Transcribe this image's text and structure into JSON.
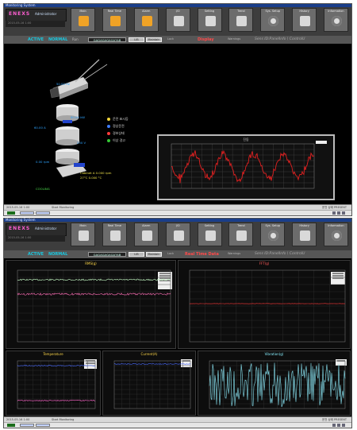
{
  "screen1": {
    "title_bar": "Monitoring System",
    "brand": "ENEXS",
    "user": "Administrator",
    "nav": [
      {
        "label": "Main",
        "icon": "home-icon"
      },
      {
        "label": "Real Time",
        "icon": "flow-icon"
      },
      {
        "label": "Alarm",
        "icon": "alarm-icon"
      },
      {
        "label": "I/O",
        "icon": "io-icon"
      },
      {
        "label": "Setting",
        "icon": "setting-icon"
      },
      {
        "label": "Trend",
        "icon": "trend-icon"
      },
      {
        "label": "Sys. Setup",
        "icon": "gear-icon"
      },
      {
        "label": "History",
        "icon": "history-icon"
      },
      {
        "label": "Information",
        "icon": "info-icon"
      }
    ],
    "status": {
      "active": "ACTIVE",
      "mode_state": "NORMAL",
      "run_label": "Run",
      "code": "GAGAGAGAGA?AB",
      "btn1": "LIB",
      "btn2": "Maintain",
      "lock": "Lock",
      "mode": "Display",
      "right_label": "Warnings",
      "path": "Sens ID:PanelInfo \\ ControlU"
    },
    "legend": [
      {
        "label": "운전 표시등",
        "color": "#f2d63b"
      },
      {
        "label": "정상운전",
        "color": "#3f7dff"
      },
      {
        "label": "경보상태",
        "color": "#ff3b3b"
      },
      {
        "label": "이상 경고",
        "color": "#34c934"
      }
    ],
    "callouts": [
      {
        "text": "50.00 Hz",
        "cls": ""
      },
      {
        "text": "80.00 kW",
        "cls": ""
      },
      {
        "text": "60.00 A",
        "cls": ""
      },
      {
        "text": "230 V",
        "cls": ""
      },
      {
        "text": "0.00 rpm",
        "cls": ""
      },
      {
        "text": "Cabinet A 0.000 rpm",
        "cls": "y"
      },
      {
        "text": "27°C 0.000 °C",
        "cls": "y"
      },
      {
        "text": "COOLING",
        "cls": "g"
      }
    ],
    "monitor_title": "진동",
    "bottom": {
      "left": "2015-05-16 1:00",
      "mid": "Start Monitoring",
      "right": "운전 상태 PRESENT"
    }
  },
  "screen2": {
    "title_bar": "Monitoring System",
    "brand": "ENEXS",
    "user": "Administrator",
    "status": {
      "active": "ACTIVE",
      "mode_state": "NORMAL",
      "code": "GAGAGAGAGA?AB",
      "btn1": "LIB",
      "btn2": "Maintain",
      "lock": "Lock",
      "mode": "Real Time Data",
      "right_label": "Warnings",
      "path": "Sens ID:PanelInfo \\ ControlU"
    },
    "panel_titles": {
      "top_left": "RMS(g)",
      "top_right": "FFT(g)",
      "bottom_left": "Temperature",
      "bottom_mid": "Current(A)",
      "bottom_right": "Vibration(g)"
    },
    "bottom": {
      "left": "2015-05-16 1:00",
      "mid": "Start Monitoring",
      "right": "운전 상태 PRESENT"
    }
  }
}
